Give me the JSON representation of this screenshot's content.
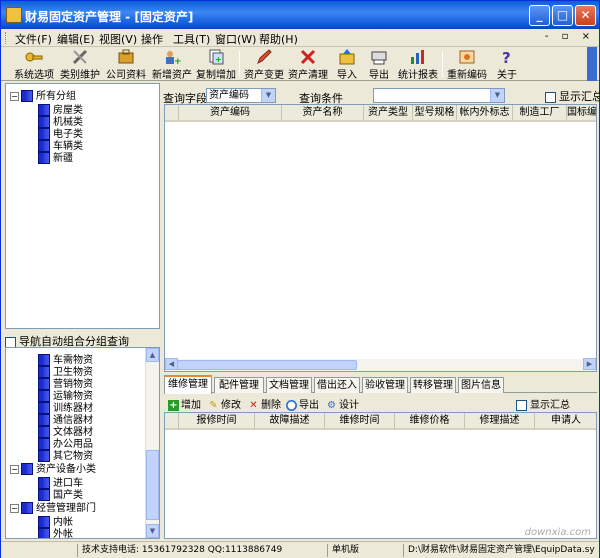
{
  "window": {
    "title": "财易固定资产管理 - [固定资产]",
    "minimize": "_",
    "maximize": "□",
    "close": "✕"
  },
  "menubar": {
    "items": [
      "文件(F)",
      "编辑(E)",
      "视图(V)",
      "操作",
      "工具(T)",
      "窗口(W)",
      "帮助(H)"
    ],
    "mdi_controls": "- ▫ ×"
  },
  "toolbar": {
    "buttons": [
      {
        "label": "系统选项",
        "icon": "key-icon"
      },
      {
        "label": "类别维护",
        "icon": "tools-icon"
      },
      {
        "label": "公司资料",
        "icon": "briefcase-icon"
      },
      {
        "label": "新增资产",
        "icon": "add-person-icon"
      },
      {
        "label": "复制增加",
        "icon": "copy-icon"
      },
      {
        "label": "资产变更",
        "icon": "pencil-icon"
      },
      {
        "label": "资产清理",
        "icon": "delete-x-icon"
      },
      {
        "label": "导入",
        "icon": "import-icon"
      },
      {
        "label": "导出",
        "icon": "export-icon"
      },
      {
        "label": "统计报表",
        "icon": "bar-chart-icon"
      },
      {
        "label": "重新编码",
        "icon": "recode-icon"
      },
      {
        "label": "关于",
        "icon": "help-icon"
      }
    ]
  },
  "tree_top": {
    "root": "所有分组",
    "children": [
      "房屋类",
      "机械类",
      "电子类",
      "车辆类",
      "新疆"
    ]
  },
  "nav_checkbox": {
    "label": "导航自动组合分组查询"
  },
  "tree_bottom": {
    "items": [
      {
        "label": "车需物资",
        "level": 2
      },
      {
        "label": "卫生物资",
        "level": 2
      },
      {
        "label": "营销物资",
        "level": 2
      },
      {
        "label": "运输物资",
        "level": 2
      },
      {
        "label": "训练器材",
        "level": 2
      },
      {
        "label": "通信器材",
        "level": 2
      },
      {
        "label": "文体器材",
        "level": 2
      },
      {
        "label": "办公用品",
        "level": 2
      },
      {
        "label": "其它物资",
        "level": 2
      },
      {
        "label": "资产设备小类",
        "level": 1
      },
      {
        "label": "进口车",
        "level": 2
      },
      {
        "label": "国产类",
        "level": 2
      },
      {
        "label": "经营管理部门",
        "level": 1
      },
      {
        "label": "内帐",
        "level": 2
      },
      {
        "label": "外帐",
        "level": 2
      }
    ]
  },
  "query": {
    "field_label": "查询字段",
    "field_value": "资产编码",
    "cond_label": "查询条件",
    "cond_value": "",
    "show_summary": "显示汇总"
  },
  "grid1": {
    "columns": [
      "",
      "资产编码",
      "资产名称",
      "资产类型",
      "型号规格",
      "帐内外标志",
      "制造工厂",
      "国标编"
    ]
  },
  "tabs": {
    "items": [
      "维修管理",
      "配件管理",
      "文档管理",
      "借出还入",
      "验收管理",
      "转移管理",
      "图片信息"
    ],
    "active": 0
  },
  "subtoolbar": {
    "add": "增加",
    "edit": "修改",
    "delete": "删除",
    "export": "导出",
    "design": "设计",
    "show_summary": "显示汇总"
  },
  "grid2": {
    "columns": [
      "",
      "报修时间",
      "故障描述",
      "维修时间",
      "维修价格",
      "修理描述",
      "申请人"
    ]
  },
  "status": {
    "support": "技术支持电话: 15361792328 QQ:1113886749",
    "mode": "单机版",
    "path": "D:\\财易软件\\财易固定资产管理\\EquipData.sy"
  },
  "watermark": "downxia.com",
  "colors": {
    "title_bar": "#0a5fd8",
    "tree_icon": "#1a2ccf",
    "active_tab": "#e68b2c"
  }
}
